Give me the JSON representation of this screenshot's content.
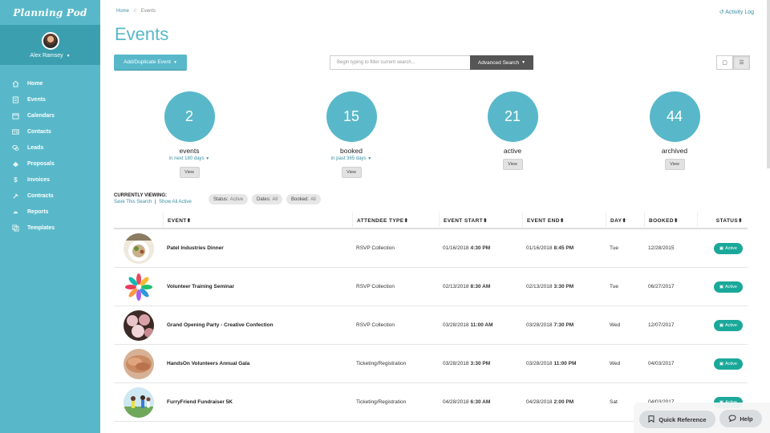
{
  "brand": "Planning Pod",
  "user": {
    "name": "Alex Ramsey"
  },
  "nav": [
    {
      "label": "Home",
      "icon": "home-icon"
    },
    {
      "label": "Events",
      "icon": "events-icon"
    },
    {
      "label": "Calendars",
      "icon": "calendar-icon"
    },
    {
      "label": "Contacts",
      "icon": "contacts-icon"
    },
    {
      "label": "Leads",
      "icon": "leads-icon"
    },
    {
      "label": "Proposals",
      "icon": "proposals-icon"
    },
    {
      "label": "Invoices",
      "icon": "dollar-icon"
    },
    {
      "label": "Contracts",
      "icon": "contracts-icon"
    },
    {
      "label": "Reports",
      "icon": "reports-icon"
    },
    {
      "label": "Templates",
      "icon": "templates-icon"
    }
  ],
  "breadcrumb": {
    "home": "Home",
    "sep": "//",
    "current": "Events"
  },
  "activity_log": "Activity Log",
  "page_title": "Events",
  "toolbar": {
    "add_label": "Add/Duplicate Event",
    "search_placeholder": "Begin typing to filter current search...",
    "advanced_label": "Advanced Search"
  },
  "stats": [
    {
      "value": "2",
      "label": "events",
      "sub": "in next 180 days",
      "view": "View"
    },
    {
      "value": "15",
      "label": "booked",
      "sub": "in past 365 days",
      "view": "View"
    },
    {
      "value": "21",
      "label": "active",
      "sub": "",
      "view": "View"
    },
    {
      "value": "44",
      "label": "archived",
      "sub": "",
      "view": "View"
    }
  ],
  "viewing": {
    "title": "CURRENTLY VIEWING:",
    "save": "Save This Search",
    "sep": "|",
    "show_all": "Show All Active"
  },
  "chips": [
    {
      "key": "Status:",
      "value": "Active"
    },
    {
      "key": "Dates:",
      "value": "All"
    },
    {
      "key": "Booked:",
      "value": "All"
    }
  ],
  "table": {
    "headers": [
      "EVENT",
      "ATTENDEE TYPE",
      "EVENT START",
      "EVENT END",
      "DAY",
      "BOOKED",
      "STATUS"
    ],
    "rows": [
      {
        "name": "Patel Industries Dinner",
        "type": "RSVP Collection",
        "start_date": "01/16/2018",
        "start_time": "4:30 PM",
        "end_date": "01/16/2018",
        "end_time": "8:45 PM",
        "day": "Tue",
        "booked": "12/28/2015",
        "status": "Active",
        "thumb": "dinner"
      },
      {
        "name": "Volunteer Training Seminar",
        "type": "RSVP Collection",
        "start_date": "02/13/2018",
        "start_time": "8:30 AM",
        "end_date": "02/13/2018",
        "end_time": "3:30 PM",
        "day": "Tue",
        "booked": "06/27/2017",
        "status": "Active",
        "thumb": "hands"
      },
      {
        "name": "Grand Opening Party - Creative Confection",
        "type": "RSVP Collection",
        "start_date": "03/28/2018",
        "start_time": "11:00 AM",
        "end_date": "03/28/2018",
        "end_time": "7:30 PM",
        "day": "Wed",
        "booked": "12/07/2017",
        "status": "Active",
        "thumb": "cupcakes"
      },
      {
        "name": "HandsOn Volunteers Annual Gala",
        "type": "Ticketing/Registration",
        "start_date": "03/28/2018",
        "start_time": "3:30 PM",
        "end_date": "03/28/2018",
        "end_time": "11:00 PM",
        "day": "Wed",
        "booked": "04/03/2017",
        "status": "Active",
        "thumb": "teamhands"
      },
      {
        "name": "FurryFriend Fundraiser 5K",
        "type": "Ticketing/Registration",
        "start_date": "04/28/2018",
        "start_time": "6:30 AM",
        "end_date": "04/28/2018",
        "end_time": "2:00 PM",
        "day": "Sat",
        "booked": "04/03/2017",
        "status": "Active",
        "thumb": "runners"
      }
    ]
  },
  "float": {
    "quick_ref": "Quick Reference",
    "help": "Help"
  },
  "colors": {
    "accent": "#58b8c9",
    "sidebar_dark": "#3c9fb0",
    "status": "#1aa89a",
    "dark_button": "#555555"
  }
}
